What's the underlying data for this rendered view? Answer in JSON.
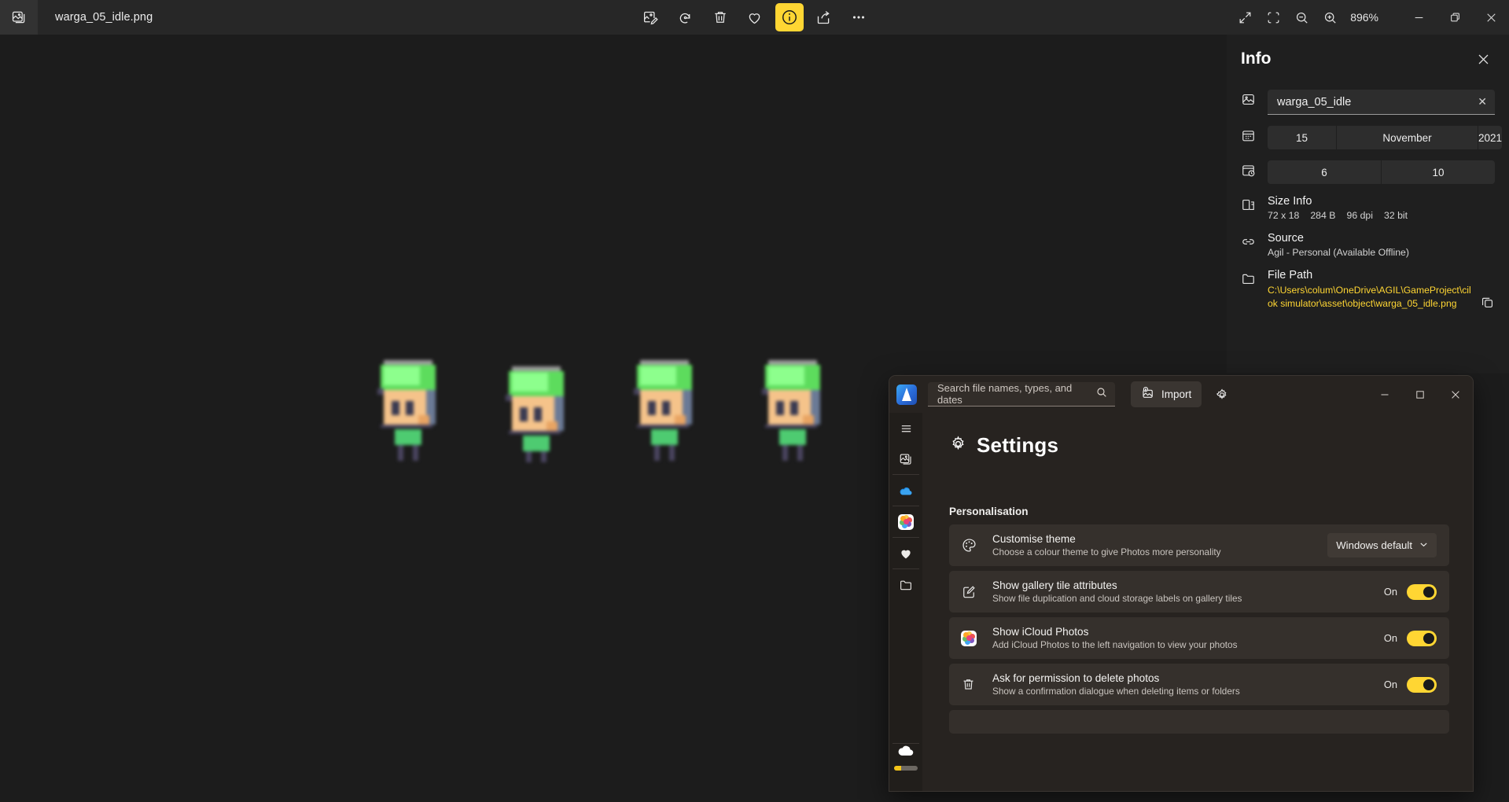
{
  "viewer": {
    "app_icon": "photo-stack-icon",
    "filename": "warga_05_idle.png",
    "toolbar": [
      {
        "name": "edit-image-button",
        "icon": "edit-image-icon",
        "active": false
      },
      {
        "name": "rotate-button",
        "icon": "rotate-icon",
        "active": false
      },
      {
        "name": "delete-button",
        "icon": "trash-icon",
        "active": false
      },
      {
        "name": "favorite-button",
        "icon": "heart-icon",
        "active": false
      },
      {
        "name": "info-button",
        "icon": "info-circle-icon",
        "active": true
      },
      {
        "name": "share-button",
        "icon": "share-icon",
        "active": false
      },
      {
        "name": "more-options-button",
        "icon": "ellipsis-icon",
        "active": false
      }
    ],
    "right_tools": [
      {
        "name": "expand-button",
        "icon": "diagonal-arrows-icon"
      },
      {
        "name": "fit-to-window-button",
        "icon": "fit-frame-icon"
      },
      {
        "name": "zoom-out-button",
        "icon": "magnifier-minus-icon"
      },
      {
        "name": "zoom-in-button",
        "icon": "magnifier-plus-icon"
      }
    ],
    "zoom_level": "896%",
    "window_controls": [
      "minimize",
      "restore",
      "close"
    ]
  },
  "info": {
    "title": "Info",
    "close_label": "✕",
    "name_field": {
      "icon": "image-icon",
      "value": "warga_05_idle",
      "clear": "✕"
    },
    "date": {
      "icon": "calendar-icon",
      "day": "15",
      "month": "November",
      "year": "2021"
    },
    "time": {
      "icon": "clock-icon",
      "hour": "6",
      "minute": "10"
    },
    "size_info": {
      "icon": "dimensions-icon",
      "label": "Size Info",
      "values": [
        "72 x 18",
        "284 B",
        "96 dpi",
        "32 bit"
      ]
    },
    "source": {
      "icon": "link-icon",
      "label": "Source",
      "value": "Agil - Personal (Available Offline)"
    },
    "file_path": {
      "icon": "folder-icon",
      "label": "File Path",
      "value": "C:\\Users\\colum\\OneDrive\\AGIL\\GameProject\\cilok simulator\\asset\\object\\warga_05_idle.png",
      "copy_icon": "copy-icon",
      "color": "#ffd633"
    }
  },
  "settings_window": {
    "app_logo": "photos-logo",
    "search": {
      "placeholder": "Search file names, types, and dates",
      "value": "",
      "icon": "search-icon"
    },
    "import_label": "Import",
    "import_icon": "import-image-icon",
    "gear_icon": "gear-icon",
    "window_controls": {
      "minimize": "─",
      "maximize": "☐",
      "close": "✕"
    },
    "nav": [
      {
        "name": "sidebar-menu-toggle",
        "icon": "hamburger-icon"
      },
      {
        "name": "sidebar-item-gallery",
        "icon": "photo-icon"
      },
      {
        "name": "sidebar-item-onedrive",
        "icon": "onedrive-cloud-icon"
      },
      {
        "name": "sidebar-item-icloud-photos",
        "icon": "icloud-photos-icon"
      },
      {
        "name": "sidebar-item-favourites",
        "icon": "heart-icon"
      },
      {
        "name": "sidebar-item-folders",
        "icon": "folder-icon"
      }
    ],
    "storage": {
      "icon": "cloud-icon",
      "bar_percent": 30
    },
    "page_title": "Settings",
    "page_title_icon": "gear-icon",
    "section": "Personalisation",
    "rows": [
      {
        "name": "customise-theme",
        "icon": "palette-icon",
        "title": "Customise theme",
        "sub": "Choose a colour theme to give Photos more personality",
        "control": "dropdown",
        "value": "Windows default"
      },
      {
        "name": "show-gallery-tile-attributes",
        "icon": "edit-square-icon",
        "title": "Show gallery tile attributes",
        "sub": "Show file duplication and cloud storage labels on gallery tiles",
        "control": "toggle",
        "value": "On"
      },
      {
        "name": "show-icloud-photos",
        "icon": "icloud-photos-icon",
        "title": "Show iCloud Photos",
        "sub": "Add iCloud Photos to the left navigation to view your photos",
        "control": "toggle",
        "value": "On"
      },
      {
        "name": "ask-permission-delete-photos",
        "icon": "trash-icon",
        "title": "Ask for permission to delete photos",
        "sub": "Show a confirmation dialogue when deleting items or folders",
        "control": "toggle",
        "value": "On"
      }
    ]
  },
  "image_content": {
    "description": "pixel-art character idle animation strip, 4 frames",
    "frames": 4,
    "colors": {
      "hat": "#5ddc5d",
      "hat_light": "#8dff8d",
      "skin": "#f5c38a",
      "eyes": "#3a3a52",
      "shirt": "#4ecb71",
      "outline": "#4a4560"
    }
  }
}
